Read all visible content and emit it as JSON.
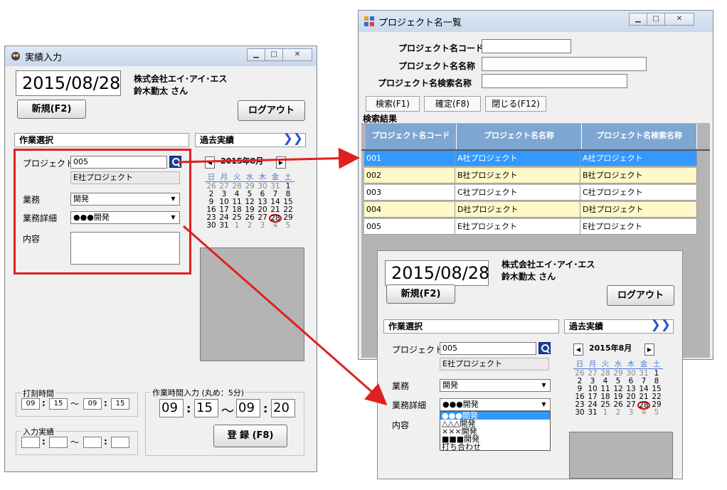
{
  "left_window": {
    "title": "実績入力",
    "date": "2015/08/28",
    "company": "株式会社エイ･アイ･エス",
    "user": "鈴木勤太 さん",
    "new_button": "新規(F2)",
    "logout_button": "ログアウト",
    "work_section": "作業選択",
    "history_section": "過去実績",
    "project_label": "プロジェクト",
    "project_code": "005",
    "project_name": "E社プロジェクト",
    "task_label": "業務",
    "task_value": "開発",
    "task_detail_label": "業務詳細",
    "task_detail_value": "●●●開発",
    "content_label": "内容",
    "stamp_group": "打刻時間",
    "stamp_from_h": "09",
    "stamp_from_m": "15",
    "stamp_to_h": "09",
    "stamp_to_m": "15",
    "tilde": "～",
    "colon": ":",
    "worktime_group": "作業時間入力 (丸め：5分)",
    "work_from_h": "09",
    "work_from_m": "15",
    "work_to_h": "09",
    "work_to_m": "20",
    "record_group": "入力実績",
    "register_button": "登 録 (F8)"
  },
  "calendar": {
    "prev": "◀",
    "next": "▶",
    "month": "2015年8月",
    "weekdays": [
      "日",
      "月",
      "火",
      "水",
      "木",
      "金",
      "土"
    ],
    "weeks": [
      [
        "26",
        "27",
        "28",
        "29",
        "30",
        "31",
        "1"
      ],
      [
        "2",
        "3",
        "4",
        "5",
        "6",
        "7",
        "8"
      ],
      [
        "9",
        "10",
        "11",
        "12",
        "13",
        "14",
        "15"
      ],
      [
        "16",
        "17",
        "18",
        "19",
        "20",
        "21",
        "22"
      ],
      [
        "23",
        "24",
        "25",
        "26",
        "27",
        "28",
        "29"
      ],
      [
        "30",
        "31",
        "1",
        "2",
        "3",
        "4",
        "5"
      ]
    ]
  },
  "project_window": {
    "title": "プロジェクト名一覧",
    "code_label": "プロジェクト名コード",
    "name_label": "プロジェクト名名称",
    "search_name_label": "プロジェクト名検索名称",
    "search_button": "検索(F1)",
    "confirm_button": "確定(F8)",
    "close_button": "閉じる(F12)",
    "results_label": "検索結果",
    "columns": [
      "プロジェクト名コード",
      "プロジェクト名名称",
      "プロジェクト名検索名称"
    ],
    "rows": [
      [
        "001",
        "A社プロジェクト",
        "A社プロジェクト"
      ],
      [
        "002",
        "B社プロジェクト",
        "B社プロジェクト"
      ],
      [
        "003",
        "C社プロジェクト",
        "C社プロジェクト"
      ],
      [
        "004",
        "D社プロジェクト",
        "D社プロジェクト"
      ],
      [
        "005",
        "E社プロジェクト",
        "E社プロジェクト"
      ]
    ]
  },
  "dropdown_options": [
    "●●●開発",
    "△△△開発",
    "×××開発",
    "■■■開発",
    "打ち合わせ"
  ],
  "colors": {
    "highlight_red": "#e02020",
    "grid_header": "#7da6d1",
    "selected_row": "#3399ff",
    "yellow_row": "#fff8c8",
    "calendar_blue": "#4d7bd8"
  }
}
